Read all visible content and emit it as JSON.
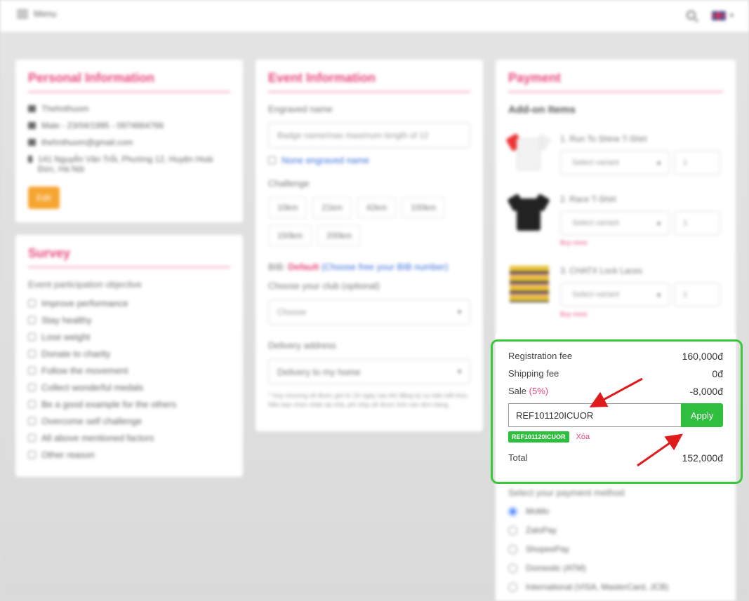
{
  "topbar": {
    "menu_label": "Menu"
  },
  "personal": {
    "title": "Personal Information",
    "lines": [
      "Thehnthuom",
      "Male - 23/04/1995 - 0974664766",
      "thehnthuom@gmail.com",
      "141 Nguyễn Văn Trỗi, Phường 12, Huyện Hoài Đức, Hà Nội"
    ],
    "edit_label": "Edit"
  },
  "survey": {
    "title": "Survey",
    "question": "Event participation objective",
    "options": [
      "Improve performance",
      "Stay healthy",
      "Lose weight",
      "Donate to charity",
      "Follow the movement",
      "Collect wonderful medals",
      "Be a good example for the others",
      "Overcome self challenge",
      "All above mentioned factors",
      "Other reason"
    ]
  },
  "event": {
    "title": "Event Information",
    "engraved_label": "Engraved name",
    "engraved_placeholder": "Badge name/max maximum length of 12",
    "none_engraved": "None engraved name",
    "challenge_label": "Challenge",
    "challenges_row1": [
      "10km",
      "21km",
      "42km",
      "100km"
    ],
    "challenges_row2": [
      "150km",
      "200km"
    ],
    "bib_prefix": "BIB:",
    "bib_default": "Default",
    "bib_link": "(Choose free your BIB number)",
    "club_label": "Choose your club (optional)",
    "club_placeholder": "Choose",
    "delivery_label": "Delivery address",
    "delivery_value": "Delivery to my home",
    "delivery_note": "* Huy chương sẽ được gửi từ 24 ngày sau khi đăng ký sự kiện kết thúc. Nếu bạn chọn nhận tại nhà, phí ship sẽ được tính vào đơn hàng."
  },
  "payment": {
    "title": "Payment",
    "addon_title": "Add-on Items",
    "addons": [
      {
        "name": "1. Run To Shine T-Shirt",
        "select": "Select variant",
        "qty": "1",
        "buy_more": ""
      },
      {
        "name": "2. Race T-Shirt",
        "select": "Select variant",
        "qty": "1",
        "buy_more": "Buy more"
      },
      {
        "name": "3. CHATX Lock Laces",
        "select": "Select variant",
        "qty": "1",
        "buy_more": "Buy more"
      }
    ],
    "method_label": "Select your payment method",
    "methods": [
      "MoMo",
      "ZaloPay",
      "ShopeePay",
      "Domestic (ATM)",
      "International (VISA, MasterCard, JCB)"
    ]
  },
  "summary": {
    "registration_label": "Registration fee",
    "registration_value": "160,000đ",
    "shipping_label": "Shipping fee",
    "shipping_value": "0đ",
    "sale_label": "Sale",
    "sale_pct": "(5%)",
    "sale_value": "-8,000đ",
    "coupon_value": "REF101120ICUOR",
    "apply_label": "Apply",
    "applied_tag": "REF101120ICUOR",
    "remove_label": "Xóa",
    "total_label": "Total",
    "total_value": "152,000đ"
  },
  "colors": {
    "accent": "#e5467a",
    "apply_green": "#2fbf3f",
    "highlight_green": "#3ac93c",
    "arrow_red": "#e01b1b"
  }
}
